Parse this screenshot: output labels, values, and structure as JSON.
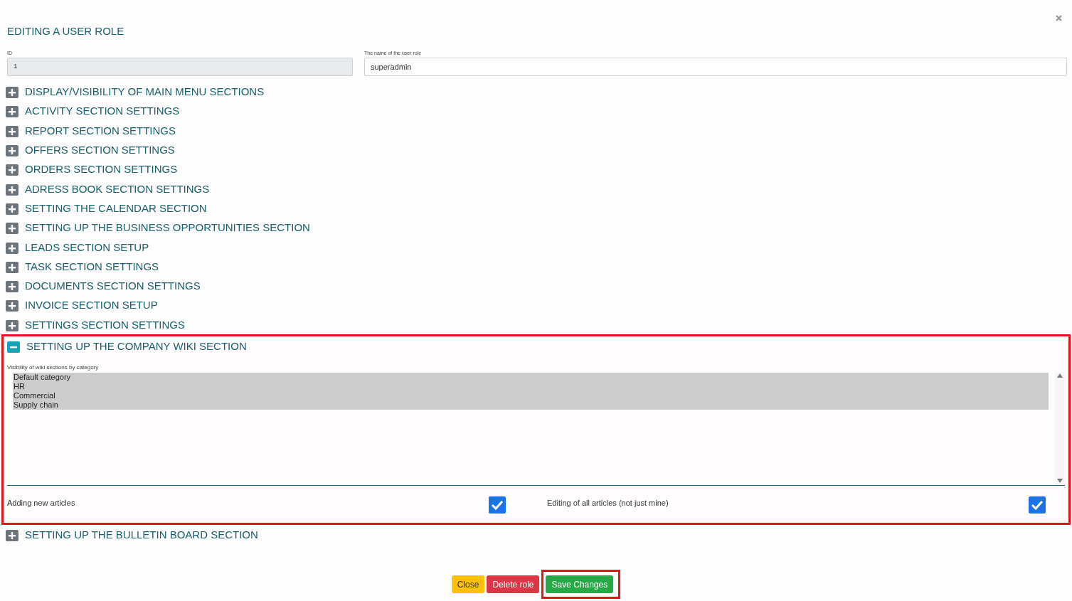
{
  "dialog": {
    "title": "EDITING A USER ROLE",
    "fields": [
      {
        "label": "ID",
        "value": "1",
        "disabled": true
      },
      {
        "label": "The name of the user role",
        "value": "superadmin",
        "disabled": false
      }
    ],
    "sections": [
      {
        "title": "DISPLAY/VISIBILITY OF MAIN MENU SECTIONS",
        "expanded": false
      },
      {
        "title": "ACTIVITY SECTION SETTINGS",
        "expanded": false
      },
      {
        "title": "REPORT SECTION SETTINGS",
        "expanded": false
      },
      {
        "title": "OFFERS SECTION SETTINGS",
        "expanded": false
      },
      {
        "title": "ORDERS SECTION SETTINGS",
        "expanded": false
      },
      {
        "title": "ADRESS BOOK SECTION SETTINGS",
        "expanded": false
      },
      {
        "title": "SETTING THE CALENDAR SECTION",
        "expanded": false
      },
      {
        "title": "SETTING UP THE BUSINESS OPPORTUNITIES SECTION",
        "expanded": false
      },
      {
        "title": "LEADS SECTION SETUP",
        "expanded": false
      },
      {
        "title": "TASK SECTION SETTINGS",
        "expanded": false
      },
      {
        "title": "DOCUMENTS SECTION SETTINGS",
        "expanded": false
      },
      {
        "title": "INVOICE SECTION SETUP",
        "expanded": false
      },
      {
        "title": "SETTINGS SECTION SETTINGS",
        "expanded": false
      },
      {
        "title": "SETTING UP THE COMPANY WIKI SECTION",
        "expanded": true,
        "highlighted": true,
        "select": {
          "label": "Visibility of wiki sections by category",
          "options": [
            {
              "label": "Default category",
              "selected": true
            },
            {
              "label": "HR",
              "selected": true
            },
            {
              "label": "Commercial",
              "selected": true
            },
            {
              "label": "Supply chain",
              "selected": true
            }
          ]
        },
        "checkboxes": [
          {
            "label": "Adding new articles",
            "checked": true
          },
          {
            "label": "Editing of all articles (not just mine)",
            "checked": true
          }
        ]
      },
      {
        "title": "SETTING UP THE BULLETIN BOARD SECTION",
        "expanded": false
      }
    ],
    "buttons": [
      {
        "label": "Close",
        "kind": "warning"
      },
      {
        "label": "Delete role",
        "kind": "danger"
      },
      {
        "label": "Save Changes",
        "kind": "success",
        "highlighted": true
      }
    ]
  }
}
